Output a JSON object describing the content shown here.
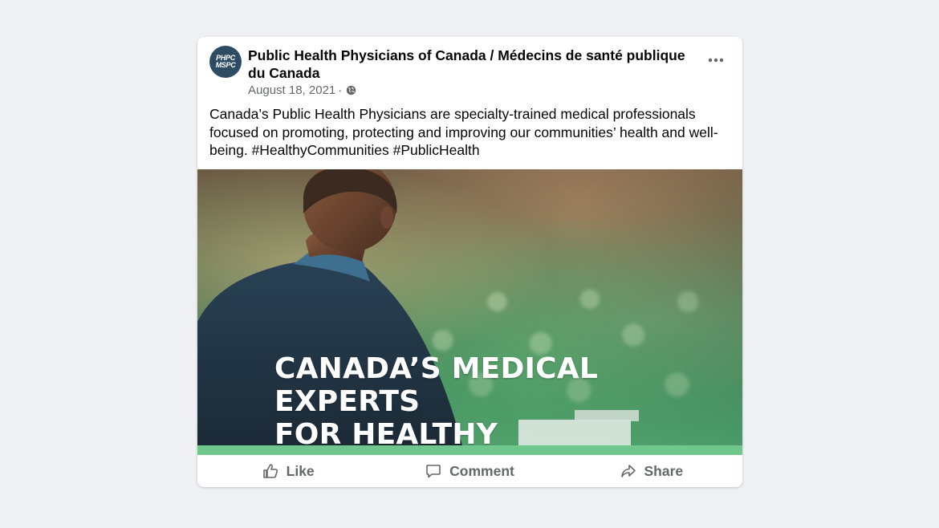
{
  "post": {
    "page_name": "Public Health Physicians of Canada / Médecins de santé publique du Canada",
    "avatar_line1": "PHPC",
    "avatar_line2": "MSPC",
    "date": "August 18, 2021",
    "separator": "·",
    "privacy_icon": "globe-icon",
    "more_icon": "more-options-icon",
    "text": "Canada’s Public Health Physicians are specialty-trained medical professionals focused on promoting, protecting and improving our communities’ health and well-being.",
    "hashtag1": "#HealthyCommunities",
    "hashtag2": "#PublicHealth"
  },
  "media": {
    "headline_line1": "CANADA’S MEDICAL EXPERTS",
    "headline_line2": "FOR HEALTHY COMMUNITIES.",
    "accent_color": "#70c78c"
  },
  "actions": {
    "like": "Like",
    "comment": "Comment",
    "share": "Share"
  }
}
